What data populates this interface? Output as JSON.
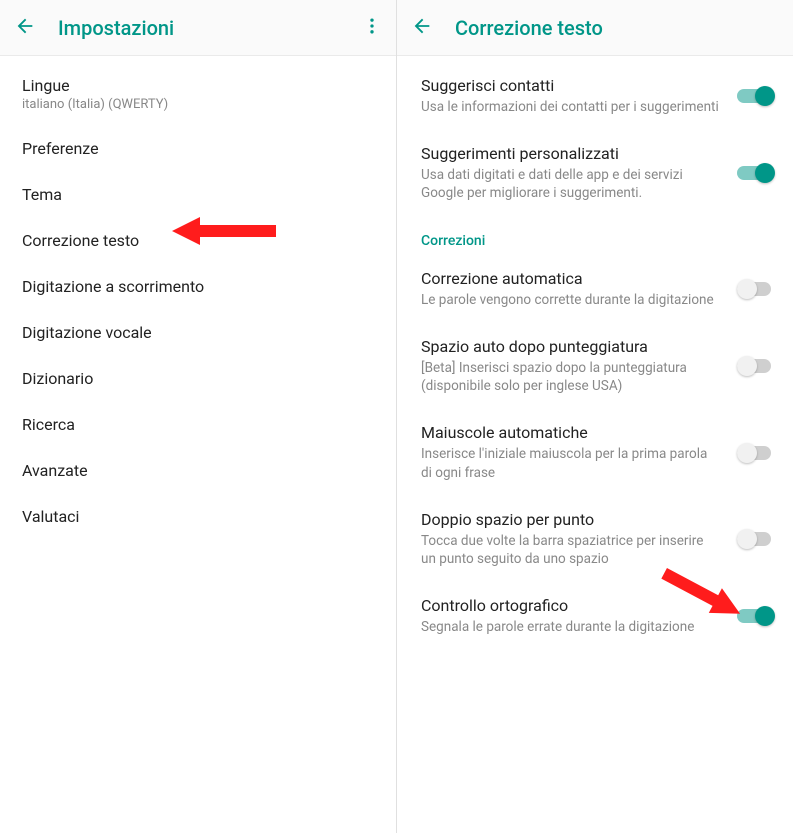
{
  "left": {
    "title": "Impostazioni",
    "items": [
      {
        "title": "Lingue",
        "sub": "italiano (Italia) (QWERTY)"
      },
      {
        "title": "Preferenze"
      },
      {
        "title": "Tema"
      },
      {
        "title": "Correzione testo"
      },
      {
        "title": "Digitazione a scorrimento"
      },
      {
        "title": "Digitazione vocale"
      },
      {
        "title": "Dizionario"
      },
      {
        "title": "Ricerca"
      },
      {
        "title": "Avanzate"
      },
      {
        "title": "Valutaci"
      }
    ]
  },
  "right": {
    "title": "Correzione testo",
    "section_a": [
      {
        "title": "Suggerisci contatti",
        "sub": "Usa le informazioni dei contatti per i suggerimenti",
        "on": true
      },
      {
        "title": "Suggerimenti personalizzati",
        "sub": "Usa dati digitati e dati delle app e dei servizi Google per migliorare i suggerimenti.",
        "on": true
      }
    ],
    "section_header": "Correzioni",
    "section_b": [
      {
        "title": "Correzione automatica",
        "sub": "Le parole vengono corrette durante la digitazione",
        "on": false
      },
      {
        "title": "Spazio auto dopo punteggiatura",
        "sub": "[Beta] Inserisci spazio dopo la punteggiatura (disponibile solo per inglese USA)",
        "on": false
      },
      {
        "title": "Maiuscole automatiche",
        "sub": "Inserisce l'iniziale maiuscola per la prima parola di ogni frase",
        "on": false
      },
      {
        "title": "Doppio spazio per punto",
        "sub": "Tocca due volte la barra spaziatrice per inserire un punto seguito da uno spazio",
        "on": false
      },
      {
        "title": "Controllo ortografico",
        "sub": "Segnala le parole errate durante la digitazione",
        "on": true
      }
    ]
  }
}
